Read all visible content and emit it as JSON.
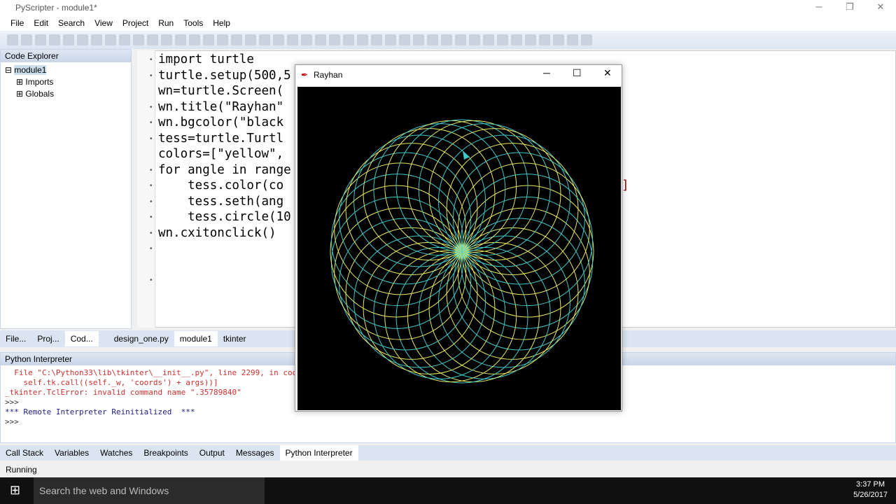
{
  "app": {
    "title": "PyScripter - module1*"
  },
  "menu": [
    "File",
    "Edit",
    "Search",
    "View",
    "Project",
    "Run",
    "Tools",
    "Help"
  ],
  "explorer": {
    "title": "Code Explorer",
    "root": "module1",
    "children": [
      "Imports",
      "Globals"
    ]
  },
  "editor": {
    "lines": [
      "import turtle",
      "turtle.setup(500,5",
      "",
      "wn=turtle.Screen(",
      "wn.title(\"Rayhan\"",
      "wn.bgcolor(\"black",
      "",
      "tess=turtle.Turtl",
      "colors=[\"yellow\",",
      "for angle in range",
      "    tess.color(co",
      "    tess.seth(ang",
      "    tess.circle(10",
      "",
      "wn.cxitonclick()"
    ],
    "trailing_bracket": "]"
  },
  "left_tabs": [
    "File...",
    "Proj...",
    "Cod..."
  ],
  "editor_tabs": [
    "design_one.py",
    "module1",
    "tkinter"
  ],
  "interpreter": {
    "title": "Python Interpreter",
    "lines": [
      {
        "text": "  File \"C:\\Python33\\lib\\tkinter\\__init__.py\", line 2299, in coo",
        "color": "#d03030"
      },
      {
        "text": "    self.tk.call((self._w, 'coords') + args))]",
        "color": "#d03030"
      },
      {
        "text": "_tkinter.TclError: invalid command name \".35789840\"",
        "color": "#d03030"
      },
      {
        "text": ">>>",
        "color": "#333"
      },
      {
        "text": "*** Remote Interpreter Reinitialized  ***",
        "color": "#202080"
      },
      {
        "text": ">>>",
        "color": "#333"
      }
    ]
  },
  "bottom_tabs": [
    "Call Stack",
    "Variables",
    "Watches",
    "Breakpoints",
    "Output",
    "Messages",
    "Python Interpreter"
  ],
  "status": "Running",
  "taskbar": {
    "search": "Search the web and Windows",
    "time": "3:37 PM",
    "date": "5/26/2017"
  },
  "turtle_window": {
    "title": "Rayhan",
    "colors": [
      "#e8e860",
      "#40c8c8"
    ],
    "center_color": "#40ff40",
    "circle_count": 36
  }
}
